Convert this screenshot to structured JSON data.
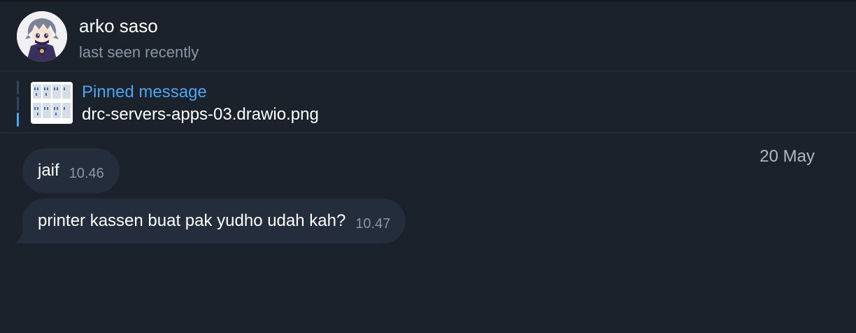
{
  "header": {
    "name": "arko saso",
    "status": "last seen recently"
  },
  "pinned": {
    "title": "Pinned message",
    "text": "drc-servers-apps-03.drawio.png"
  },
  "chat": {
    "date": "20 May",
    "messages": [
      {
        "text": "jaif",
        "time": "10.46"
      },
      {
        "text": "printer kassen buat pak yudho udah kah?",
        "time": "10.47"
      }
    ]
  },
  "colors": {
    "background": "#1b222c",
    "bubble": "#232d3b",
    "accent": "#4fa4f0",
    "muted_text": "#8b96a4"
  },
  "icons": {
    "avatar": "anime-character-avatar",
    "thumbnail": "diagram-thumbnail"
  }
}
